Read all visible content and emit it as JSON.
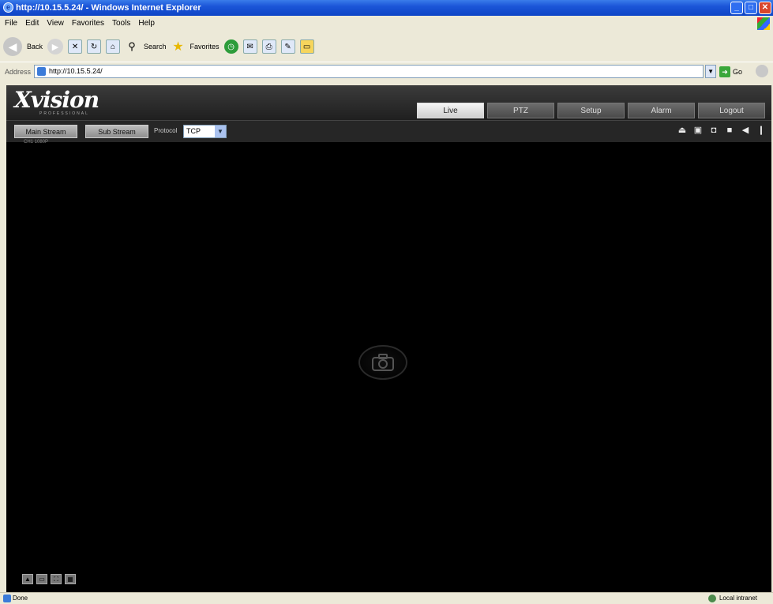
{
  "browser": {
    "title": "http://10.15.5.24/ - Windows Internet Explorer",
    "menu": [
      "File",
      "Edit",
      "View",
      "Favorites",
      "Tools",
      "Help"
    ],
    "toolbar": {
      "back_label": "Back",
      "search_label": "Search",
      "favorites_label": "Favorites"
    },
    "address_label": "Address",
    "address_value": "http://10.15.5.24/",
    "go_label": "Go",
    "status_left": "Done",
    "status_zone": "Local intranet"
  },
  "app": {
    "brand": "Xvision",
    "brand_sub": "PROFESSIONAL",
    "nav": [
      "Live",
      "PTZ",
      "Setup",
      "Alarm",
      "Logout"
    ],
    "active_tab": "Live",
    "main_stream_label": "Main Stream",
    "sub_stream_label": "Sub Stream",
    "protocol_label": "Protocol",
    "protocol_value": "TCP",
    "channel_label": "CH1 1080P"
  },
  "icons": {
    "right_tools": [
      "user-icon",
      "window-icon",
      "snapshot-icon",
      "record-icon",
      "speaker-icon",
      "microphone-icon"
    ],
    "video_tools": [
      "image-icon",
      "ratio-icon",
      "fullscreen-icon",
      "zoom-icon"
    ]
  },
  "colors": {
    "titlebar": "#1b55d8",
    "app_bg": "#000000",
    "active_tab": "#e0e0e0"
  }
}
